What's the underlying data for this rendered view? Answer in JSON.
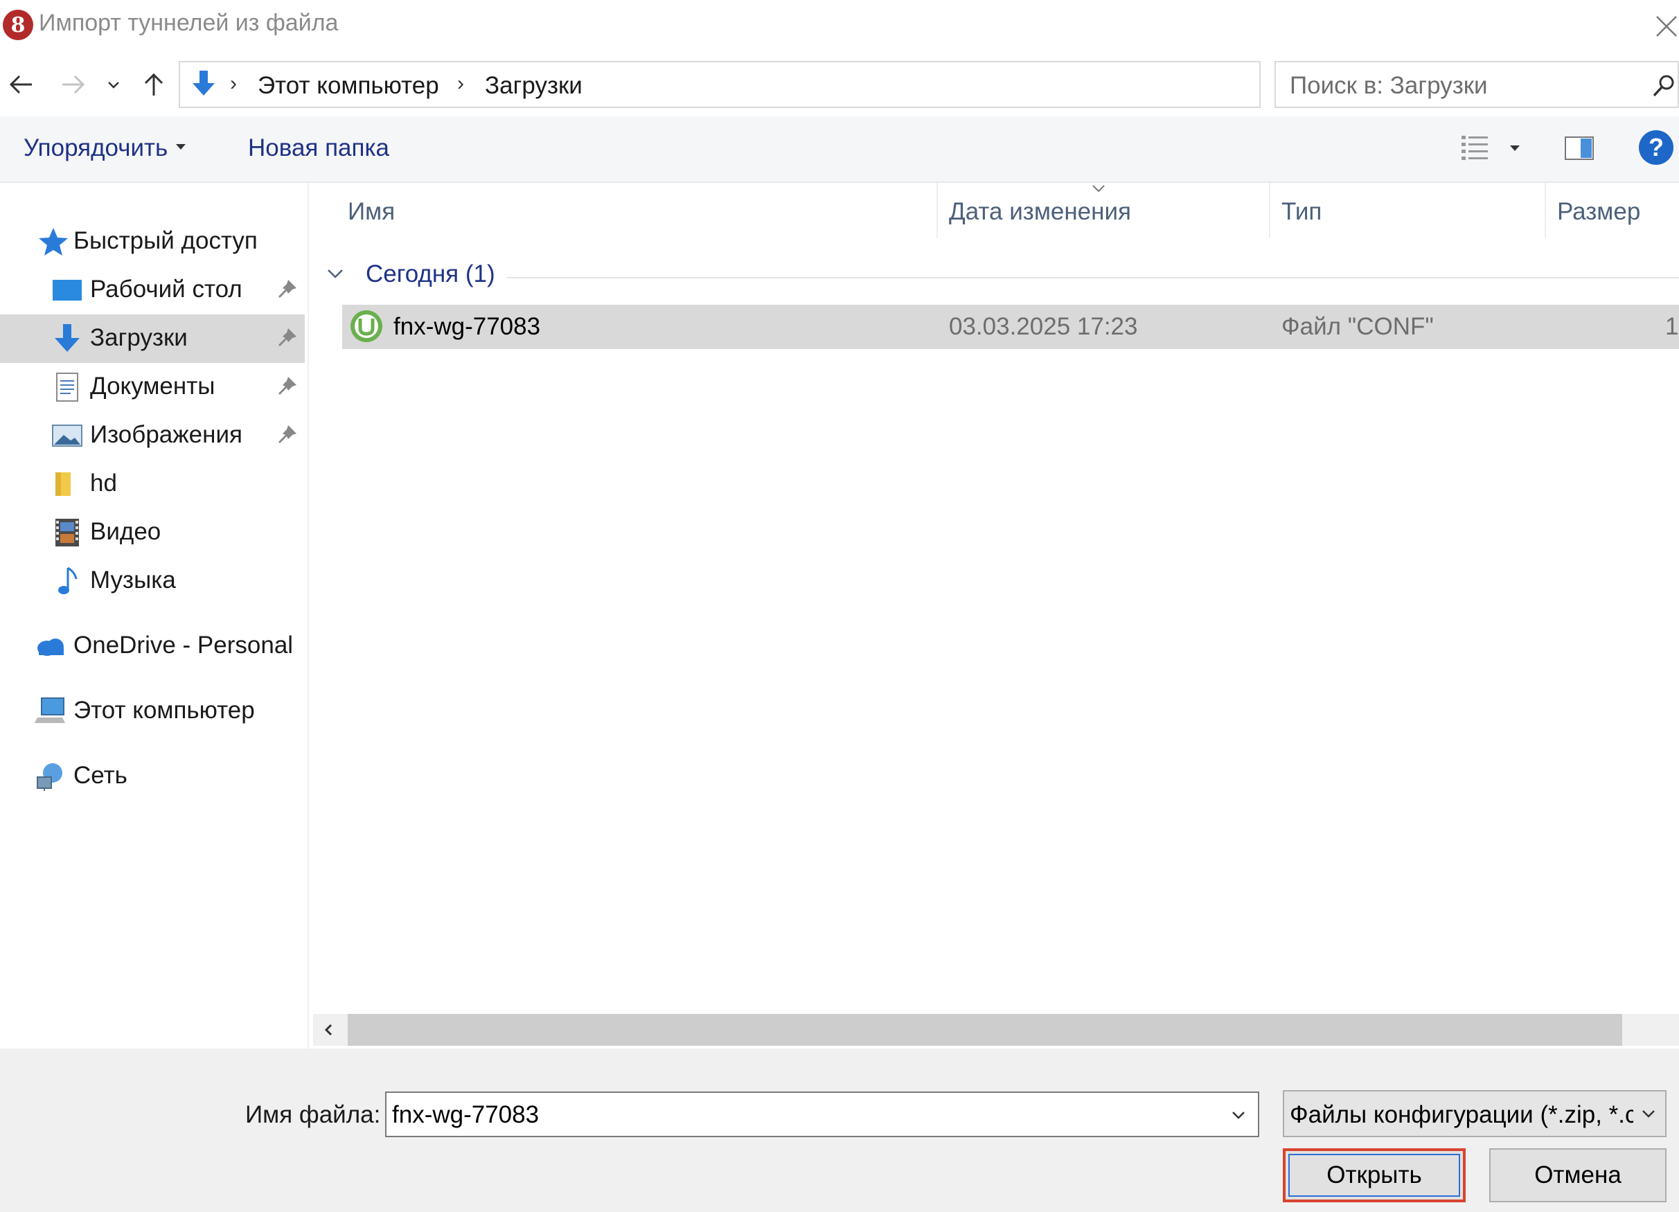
{
  "window": {
    "title": "Импорт туннелей из файла",
    "app_icon": "app-logo-icon",
    "close_icon": "close-icon"
  },
  "nav": {
    "back_icon": "arrow-left-icon",
    "forward_icon": "arrow-right-icon",
    "recent_icon": "chevron-down-icon",
    "up_icon": "arrow-up-icon"
  },
  "address": {
    "location_icon": "download-arrow-icon",
    "crumbs": [
      "Этот компьютер",
      "Загрузки"
    ],
    "refresh_icon": "refresh-icon"
  },
  "search": {
    "placeholder": "Поиск в: Загрузки",
    "icon": "search-icon"
  },
  "toolbar": {
    "organize_label": "Упорядочить",
    "new_folder_label": "Новая папка",
    "help_label": "?"
  },
  "sidebar": {
    "items": [
      {
        "label": "Быстрый доступ",
        "icon": "star-icon"
      },
      {
        "label": "Рабочий стол",
        "icon": "desktop-icon",
        "pinned": true
      },
      {
        "label": "Загрузки",
        "icon": "download-arrow-icon",
        "pinned": true,
        "selected": true
      },
      {
        "label": "Документы",
        "icon": "document-icon",
        "pinned": true
      },
      {
        "label": "Изображения",
        "icon": "pictures-icon",
        "pinned": true
      },
      {
        "label": "hd",
        "icon": "folder-icon"
      },
      {
        "label": "Видео",
        "icon": "film-icon"
      },
      {
        "label": "Музыка",
        "icon": "music-note-icon"
      },
      {
        "label": "OneDrive - Personal",
        "icon": "cloud-icon"
      },
      {
        "label": "Этот компьютер",
        "icon": "computer-icon"
      },
      {
        "label": "Сеть",
        "icon": "network-icon"
      }
    ]
  },
  "columns": {
    "name": "Имя",
    "date": "Дата изменения",
    "type": "Тип",
    "size": "Размер"
  },
  "groups": [
    {
      "label": "Сегодня (1)",
      "files": [
        {
          "name": "fnx-wg-77083",
          "date": "03.03.2025 17:23",
          "type": "Файл \"CONF\"",
          "size": "1",
          "icon": "utorrent-icon"
        }
      ]
    }
  ],
  "footer": {
    "filename_label": "Имя файла:",
    "filename_value": "fnx-wg-77083",
    "filter_value": "Файлы конфигурации (*.zip, *.c",
    "open_label": "Открыть",
    "cancel_label": "Отмена"
  },
  "colors": {
    "accent_blue": "#1e3287",
    "selection_gray": "#d9d9d9",
    "highlight_red": "#d8442f"
  }
}
